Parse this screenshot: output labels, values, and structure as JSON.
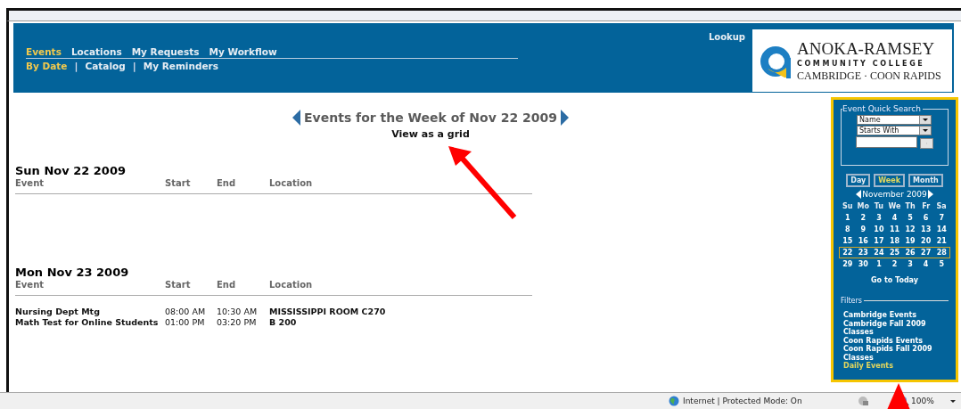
{
  "header": {
    "nav": [
      {
        "label": "Events",
        "selected": true
      },
      {
        "label": "Locations",
        "selected": false
      },
      {
        "label": "My Requests",
        "selected": false
      },
      {
        "label": "My Workflow",
        "selected": false
      }
    ],
    "subnav_separator": "|",
    "subnav": [
      {
        "label": "By Date",
        "selected": true
      },
      {
        "label": "Catalog",
        "selected": false
      },
      {
        "label": "My Reminders",
        "selected": false
      }
    ],
    "lookup": "Lookup",
    "logo": {
      "name": "ANOKA-RAMSEY",
      "line_2": "COMMUNITY COLLEGE",
      "line_3": "CAMBRIDGE · COON RAPIDS"
    }
  },
  "main": {
    "title": "Events for the Week of Nov 22 2009",
    "grid_link": "View as a grid",
    "days": [
      {
        "heading": "Sun Nov 22 2009",
        "columns": [
          "Event",
          "Start",
          "End",
          "Location"
        ]
      },
      {
        "heading": "Mon Nov 23 2009",
        "columns": [
          "Event",
          "Start",
          "End",
          "Location"
        ],
        "rows": [
          {
            "event": "Nursing Dept Mtg",
            "start": "08:00 AM",
            "end": "10:30 AM",
            "location": "MISSISSIPPI ROOM C270"
          },
          {
            "event": "Math Test for Online Students",
            "start": "01:00 PM",
            "end": "03:20 PM",
            "location": "B 200"
          }
        ]
      }
    ]
  },
  "sidebar": {
    "quick_search": {
      "legend": "Event Quick Search",
      "field": "Name",
      "match": "Starts With"
    },
    "views": [
      {
        "label": "Day",
        "selected": false
      },
      {
        "label": "Week",
        "selected": true
      },
      {
        "label": "Month",
        "selected": false
      }
    ],
    "month": "November 2009",
    "weekdays": [
      "Su",
      "Mo",
      "Tu",
      "We",
      "Th",
      "Fr",
      "Sa"
    ],
    "weeks": [
      {
        "selected": false,
        "days": [
          "1",
          "2",
          "3",
          "4",
          "5",
          "6",
          "7"
        ]
      },
      {
        "selected": false,
        "days": [
          "8",
          "9",
          "10",
          "11",
          "12",
          "13",
          "14"
        ]
      },
      {
        "selected": false,
        "days": [
          "15",
          "16",
          "17",
          "18",
          "19",
          "20",
          "21"
        ]
      },
      {
        "selected": true,
        "days": [
          "22",
          "23",
          "24",
          "25",
          "26",
          "27",
          "28"
        ]
      },
      {
        "selected": false,
        "days": [
          "29",
          "30",
          "1",
          "2",
          "3",
          "4",
          "5"
        ]
      }
    ],
    "today_link": "Go to Today",
    "filters_legend": "Filters",
    "filters": [
      {
        "label": "Cambridge Events",
        "selected": false
      },
      {
        "label": "Cambridge Fall 2009 Classes",
        "selected": false
      },
      {
        "label": "Coon Rapids Events",
        "selected": false
      },
      {
        "label": "Coon Rapids Fall 2009 Classes",
        "selected": false
      },
      {
        "label": "Daily Events",
        "selected": true
      }
    ]
  },
  "status_bar": {
    "zone": "Internet | Protected Mode: On",
    "zoom": "100%"
  }
}
